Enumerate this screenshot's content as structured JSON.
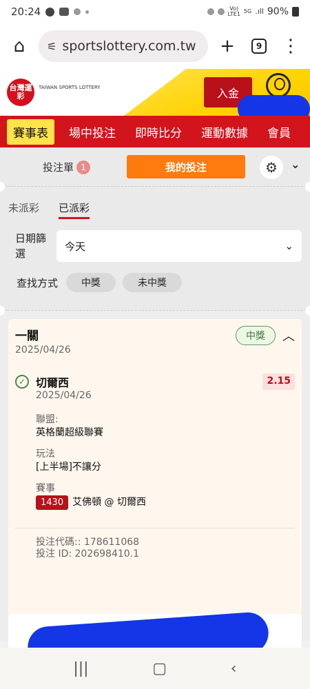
{
  "status": {
    "time": "20:24",
    "network": "5G",
    "battery": "90%"
  },
  "browser": {
    "url": "sportslottery.com.tw",
    "tab_count": "9"
  },
  "site": {
    "logo_text": "台灣運彩",
    "logo_sub": "TAIWAN SPORTS LOTTERY",
    "deposit_label": "入金"
  },
  "nav": {
    "items": [
      "賽事表",
      "場中投注",
      "即時比分",
      "運動數據",
      "會員"
    ]
  },
  "slip": {
    "label": "投注單",
    "count": "1",
    "my_bets_label": "我的投注"
  },
  "filter": {
    "tabs": [
      "未派彩",
      "已派彩"
    ],
    "date_label": "日期篩選",
    "date_value": "今天",
    "search_label": "查找方式",
    "options": [
      "中獎",
      "未中獎"
    ]
  },
  "bet": {
    "type": "一關",
    "date": "2025/04/26",
    "result": "中獎",
    "selection": "切爾西",
    "selection_date": "2025/04/26",
    "odds": "2.15",
    "league_label": "聯盟:",
    "league": "英格蘭超級聯賽",
    "play_label": "玩法",
    "play": "[上半場]不讓分",
    "event_label": "賽事",
    "event_id": "1430",
    "event_name": "艾佛頓 @ 切爾西",
    "code_line": "投注代碼:: 178611068",
    "id_line": "投注 ID: 202698410.1"
  }
}
